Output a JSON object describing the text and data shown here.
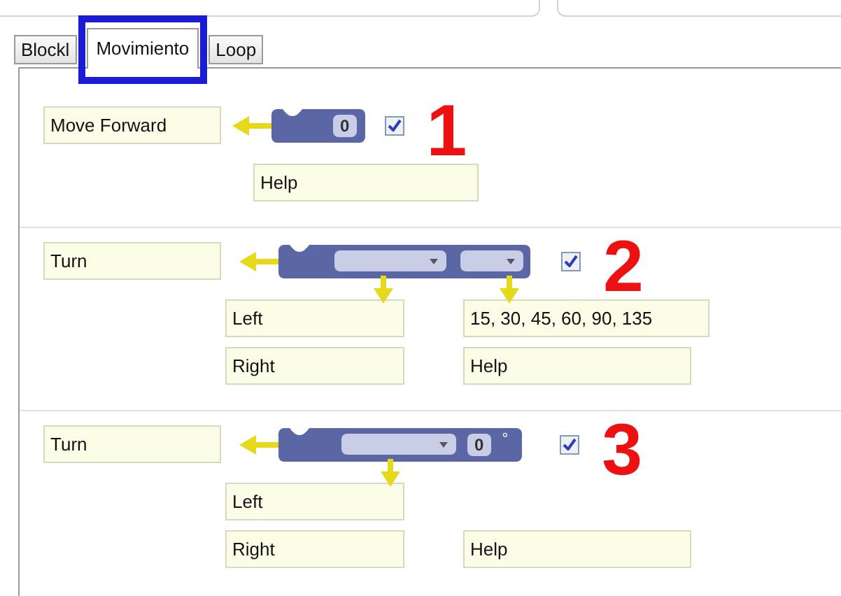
{
  "tabs": [
    {
      "label": "Blockl",
      "selected": false,
      "highlighted": false
    },
    {
      "label": "Movimiento",
      "selected": true,
      "highlighted": true
    },
    {
      "label": "Loop",
      "selected": false,
      "highlighted": false
    }
  ],
  "sections": [
    {
      "number": "1",
      "name": "Move Forward",
      "checked": true,
      "block": {
        "kind": "number",
        "value": "0"
      },
      "rows": [
        {
          "middle": "Help"
        }
      ]
    },
    {
      "number": "2",
      "name": "Turn",
      "checked": true,
      "block": {
        "kind": "two-dropdowns"
      },
      "rows": [
        {
          "left": "Left",
          "right": "15, 30, 45, 60, 90, 135"
        },
        {
          "left": "Right",
          "right": "Help"
        }
      ]
    },
    {
      "number": "3",
      "name": "Turn",
      "checked": true,
      "block": {
        "kind": "dropdown-angle",
        "value": "0",
        "unit": "°"
      },
      "rows": [
        {
          "left": "Left"
        },
        {
          "left": "Right",
          "right": "Help"
        }
      ]
    }
  ]
}
